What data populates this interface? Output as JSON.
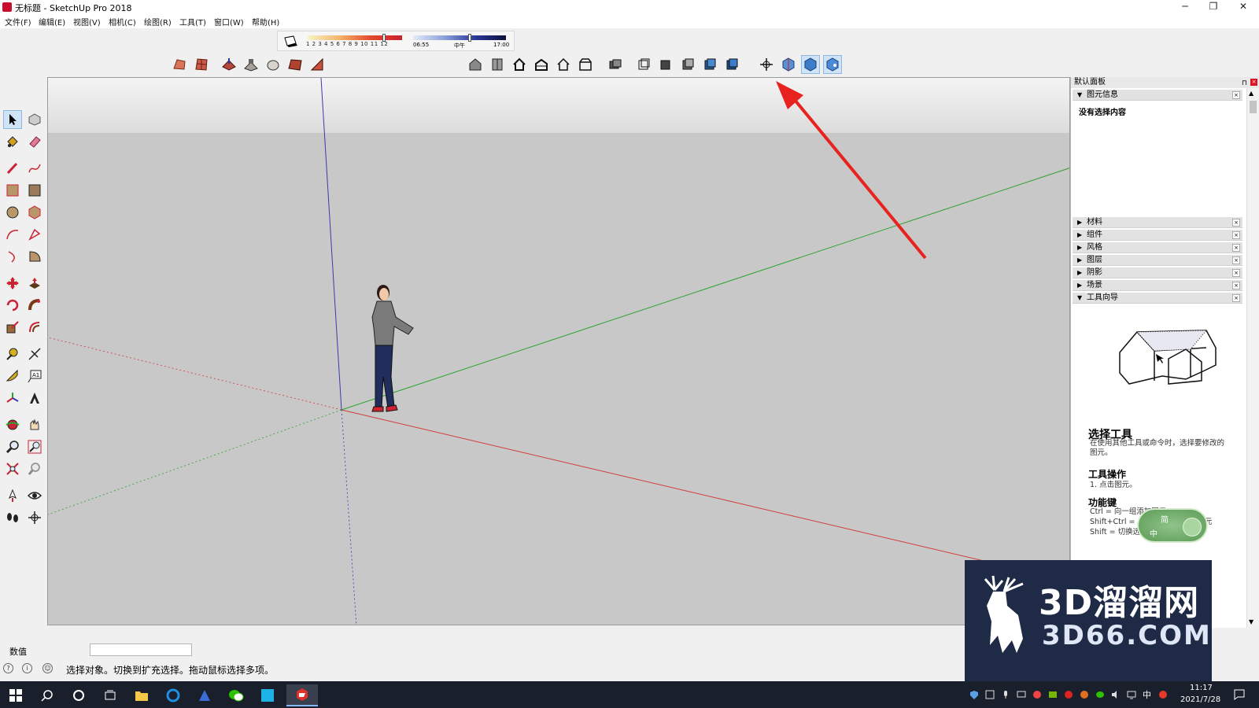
{
  "window": {
    "title": "无标题 - SketchUp Pro 2018",
    "controls": {
      "minimize": "─",
      "maximize": "❐",
      "close": "✕"
    }
  },
  "menu": {
    "items": [
      "文件(F)",
      "编辑(E)",
      "视图(V)",
      "相机(C)",
      "绘图(R)",
      "工具(T)",
      "窗口(W)",
      "帮助(H)"
    ]
  },
  "shadow_panel": {
    "months": "1 2 3 4 5 6 7 8 9 10 11 12",
    "time_start": "06:55",
    "time_noon": "中午",
    "time_end": "17:00"
  },
  "tray": {
    "title": "默认面板",
    "pin": "⊓",
    "close": "×",
    "entity_info": {
      "label": "图元信息",
      "empty_text": "没有选择内容"
    },
    "sections": [
      "材料",
      "组件",
      "风格",
      "图层",
      "阴影",
      "场景"
    ],
    "instructor": {
      "label": "工具向导",
      "title": "选择工具",
      "description": "在使用其他工具或命令时，选择要修改的图元。",
      "operations_title": "工具操作",
      "operation_1": "1. 点击图元。",
      "keys_title": "功能键",
      "keys": [
        "Ctrl = 向一组添加图元",
        "Shift+Ctrl = 从一组中去掉某个图元",
        "Shift = 切换选择状态"
      ]
    },
    "ime": {
      "top": "简",
      "left": "中"
    }
  },
  "measurements": {
    "label": "数值",
    "value": ""
  },
  "status": {
    "text": "选择对象。切换到扩充选择。拖动鼠标选择多项。",
    "icon_1": "?",
    "icon_2": "i",
    "icon_3": "☺"
  },
  "watermark": {
    "brand": "3D溜溜网",
    "url": "3D66.COM"
  },
  "taskbar": {
    "time": "11:17",
    "date": "2021/7/28",
    "ime": "中"
  },
  "colors": {
    "axis_red": "#d23c3c",
    "axis_green": "#2fa22f",
    "axis_blue": "#3a3ab0",
    "arrow": "#e8231f",
    "active_button": "#cfe3f7"
  }
}
